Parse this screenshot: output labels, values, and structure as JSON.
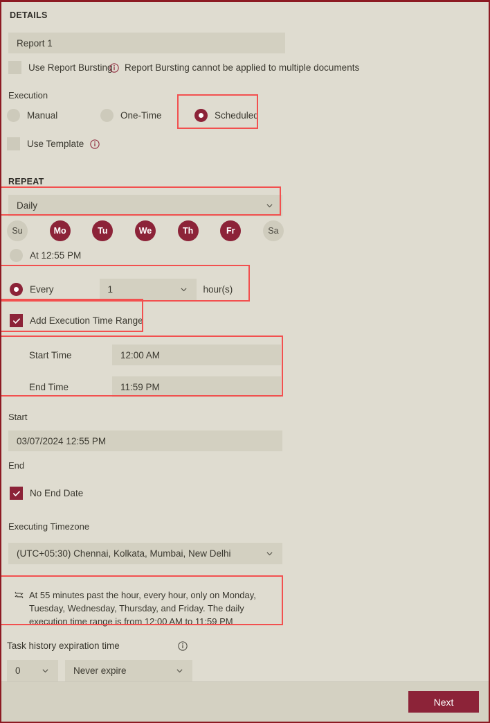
{
  "details": {
    "section_title": "DETAILS",
    "report_name": "Report 1",
    "use_report_bursting_label": "Use Report Bursting",
    "report_bursting_info": "Report Bursting cannot be applied to multiple documents",
    "report_bursting_info_icon": "info-circle-icon",
    "execution_label": "Execution",
    "execution_options": [
      {
        "label": "Manual",
        "selected": false
      },
      {
        "label": "One-Time",
        "selected": false
      },
      {
        "label": "Scheduled",
        "selected": true
      }
    ],
    "use_template_label": "Use Template",
    "use_template_checked": false,
    "use_template_info_icon": "info-circle-icon"
  },
  "repeat": {
    "section_title": "REPEAT",
    "frequency_value": "Daily",
    "frequency_chevron_icon": "chevron-down-icon",
    "days": [
      {
        "abbr": "Su",
        "selected": false
      },
      {
        "abbr": "Mo",
        "selected": true
      },
      {
        "abbr": "Tu",
        "selected": true
      },
      {
        "abbr": "We",
        "selected": true
      },
      {
        "abbr": "Th",
        "selected": true
      },
      {
        "abbr": "Fr",
        "selected": true
      },
      {
        "abbr": "Sa",
        "selected": false
      }
    ],
    "at_time_label": "At 12:55 PM",
    "at_time_selected": false,
    "every_label": "Every",
    "every_selected": true,
    "every_value": "1",
    "every_chevron_icon": "chevron-down-icon",
    "every_unit_label": "hour(s)",
    "add_time_range_label": "Add Execution Time Range",
    "add_time_range_checked": true,
    "start_time_label": "Start Time",
    "start_time_value": "12:00 AM",
    "end_time_label": "End Time",
    "end_time_value": "11:59 PM"
  },
  "schedule": {
    "start_label": "Start",
    "start_value": "03/07/2024 12:55 PM",
    "end_label": "End",
    "no_end_date_label": "No End Date",
    "no_end_date_checked": true,
    "timezone_label": "Executing Timezone",
    "timezone_value": "(UTC+05:30) Chennai, Kolkata, Mumbai, New Delhi",
    "timezone_chevron_icon": "chevron-down-icon"
  },
  "summary": {
    "icon": "repeat-loop-icon",
    "text": "At 55 minutes past the hour, every hour, only on Monday, Tuesday, Wednesday, Thursday, and Friday. The daily execution time range is from 12:00 AM to 11:59 PM"
  },
  "task_history": {
    "label": "Task history expiration time",
    "info_icon": "info-circle-icon",
    "count_value": "0",
    "count_chevron_icon": "chevron-down-icon",
    "policy_value": "Never expire",
    "policy_chevron_icon": "chevron-down-icon"
  },
  "footer": {
    "next_label": "Next"
  },
  "colors": {
    "accent": "#8c2338",
    "window_border": "#8c1a22",
    "background": "#dfdcd0",
    "field_background": "#d3d0c1",
    "highlight_outline": "#f2504f",
    "footer_background": "#d4d1c2"
  }
}
